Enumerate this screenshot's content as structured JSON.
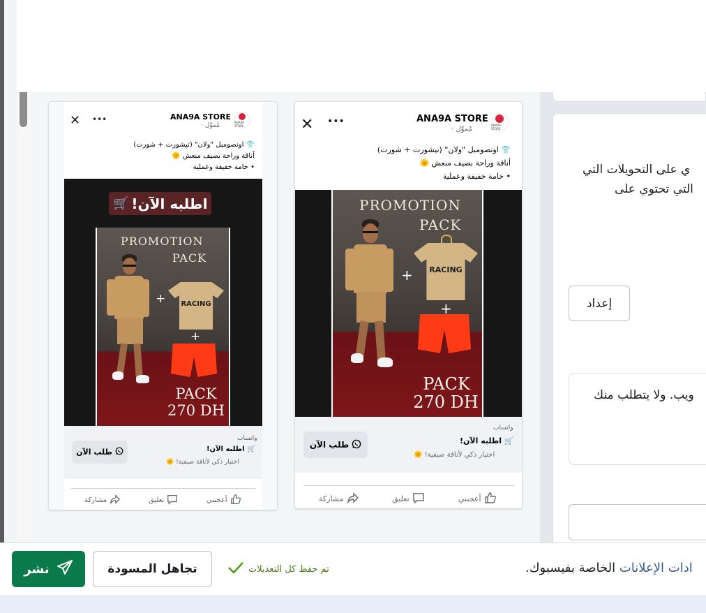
{
  "settings": {
    "conversions_line1": "ي على التحويلات التي",
    "conversions_line2": "التي تحتوي على",
    "setup_button": "إعداد",
    "info_text": "ويب. ولا يتطلب منك"
  },
  "ads": {
    "store_name": "ANA9A STORE",
    "sponsored": "مُموَّل ·",
    "avatar_text": "ANA9A STORE",
    "body_lines": [
      "👕 اونصومبل \"ولان\" (تيشورت + شورت)",
      "أناقة وراحة بصيف منعش 🌞",
      "• خامة خفيفة وعملية"
    ],
    "image": {
      "banner_text": "اطلبه الآن!",
      "banner_icon": "🛒",
      "promotion_line1": "PROMOTION",
      "promotion_line2": "PACK",
      "tshirt_text": "RACING",
      "plus": "+",
      "pack_text": "PACK",
      "price_text": "270 DH"
    },
    "cta": {
      "label": "واتساب",
      "headline": "🛒 اطلبه الآن!",
      "description": "اختيار ذكي لأناقة صيفية! 🌞",
      "button": "طلب الآن"
    },
    "reactions": {
      "like": "أعجبني",
      "comment": "تعليق",
      "share": "مشاركة"
    },
    "header_more": "•••",
    "header_close": "✕"
  },
  "footer": {
    "publish_label": "نشر",
    "discard_label": "تجاهل المسودة",
    "saved_status": "تم حفظ كل التعديلات",
    "text_link_part": "ادات الإعلانات",
    "text_rest": " الخاصة بفيسبوك."
  },
  "colors": {
    "publish_green": "#0b7a4b",
    "saved_green": "#4b7a12",
    "link_blue": "#385898"
  }
}
